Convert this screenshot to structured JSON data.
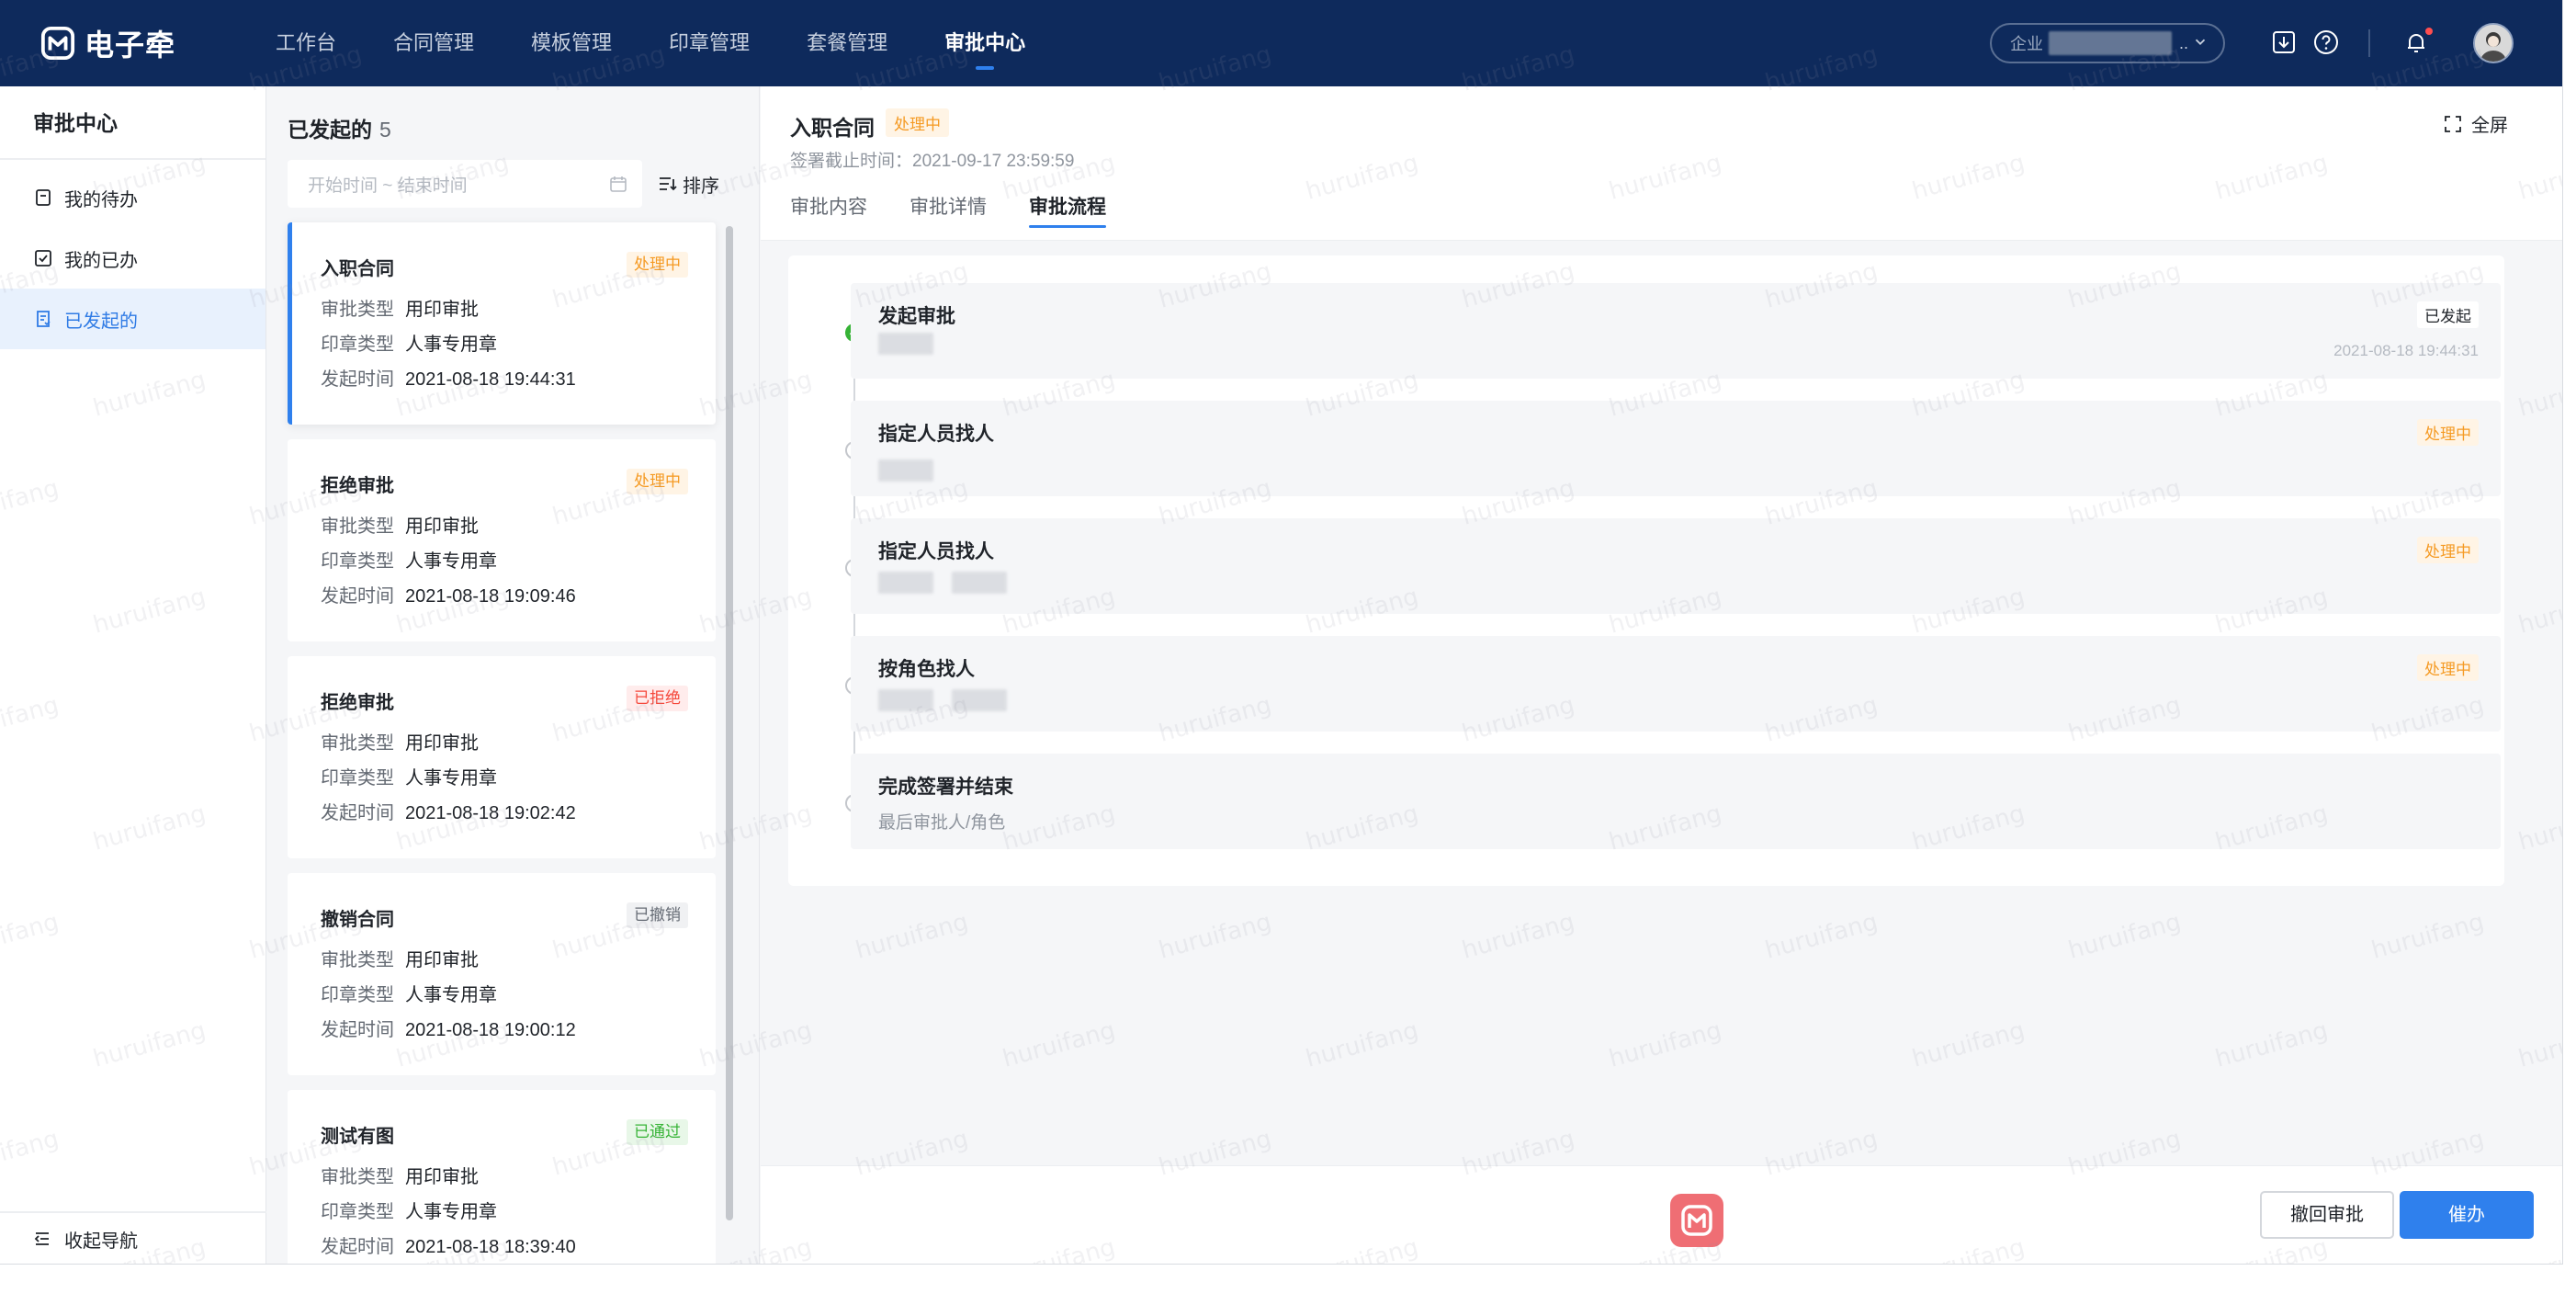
{
  "brand": {
    "name": "电子牵"
  },
  "topnav": {
    "items": [
      {
        "label": "工作台",
        "active": false
      },
      {
        "label": "合同管理",
        "active": false
      },
      {
        "label": "模板管理",
        "active": false
      },
      {
        "label": "印章管理",
        "active": false
      },
      {
        "label": "套餐管理",
        "active": false
      },
      {
        "label": "审批中心",
        "active": true
      }
    ],
    "company_prefix": "企业",
    "company_suffix": "..",
    "icons": [
      "download-icon",
      "help-icon",
      "bell-icon",
      "avatar"
    ]
  },
  "sidebar": {
    "title": "审批中心",
    "items": [
      {
        "label": "我的待办",
        "icon": "todo-icon",
        "active": false
      },
      {
        "label": "我的已办",
        "icon": "done-checkbox-icon",
        "active": false
      },
      {
        "label": "已发起的",
        "icon": "initiated-doc-icon",
        "active": true
      }
    ],
    "collapse_label": "收起导航"
  },
  "list": {
    "title": "已发起的",
    "count": "5",
    "date_placeholder": "开始时间 ~ 结束时间",
    "sort_label": "排序",
    "field_labels": {
      "approval_type": "审批类型",
      "seal_type": "印章类型",
      "start_time": "发起时间"
    },
    "cards": [
      {
        "title": "入职合同",
        "status": "处理中",
        "status_kind": "processing",
        "approval_type": "用印审批",
        "seal_type": "人事专用章",
        "start_time": "2021-08-18 19:44:31",
        "selected": true
      },
      {
        "title": "拒绝审批",
        "status": "处理中",
        "status_kind": "processing",
        "approval_type": "用印审批",
        "seal_type": "人事专用章",
        "start_time": "2021-08-18 19:09:46",
        "selected": false
      },
      {
        "title": "拒绝审批",
        "status": "已拒绝",
        "status_kind": "rejected",
        "approval_type": "用印审批",
        "seal_type": "人事专用章",
        "start_time": "2021-08-18 19:02:42",
        "selected": false
      },
      {
        "title": "撤销合同",
        "status": "已撤销",
        "status_kind": "revoked",
        "approval_type": "用印审批",
        "seal_type": "人事专用章",
        "start_time": "2021-08-18 19:00:12",
        "selected": false
      },
      {
        "title": "测试有图",
        "status": "已通过",
        "status_kind": "passed",
        "approval_type": "用印审批",
        "seal_type": "人事专用章",
        "start_time": "2021-08-18 18:39:40",
        "selected": false
      }
    ]
  },
  "detail": {
    "title": "入职合同",
    "status": "处理中",
    "deadline": "签署截止时间：2021-09-17 23:59:59",
    "fullscreen_label": "全屏",
    "tabs": [
      {
        "label": "审批内容",
        "active": false
      },
      {
        "label": "审批详情",
        "active": false
      },
      {
        "label": "审批流程",
        "active": true
      }
    ],
    "steps": [
      {
        "title": "发起审批",
        "status": "已发起",
        "status_kind": "started",
        "time": "2021-08-18 19:44:31",
        "done": true
      },
      {
        "title": "指定人员找人",
        "status": "处理中",
        "status_kind": "processing",
        "done": false
      },
      {
        "title": "指定人员找人",
        "status": "处理中",
        "status_kind": "processing",
        "done": false
      },
      {
        "title": "按角色找人",
        "status": "处理中",
        "status_kind": "processing",
        "done": false
      },
      {
        "title": "完成签署并结束",
        "status": "",
        "status_kind": "none",
        "subtitle": "最后审批人/角色",
        "done": false
      }
    ],
    "buttons": {
      "revoke": "撤回审批",
      "urge": "催办"
    }
  },
  "watermark": "huruifang",
  "colors": {
    "nav_bg": "#0e2a5c",
    "accent": "#2f80ed",
    "processing": "#f59a23",
    "rejected": "#f5483b",
    "passed": "#36b336"
  }
}
